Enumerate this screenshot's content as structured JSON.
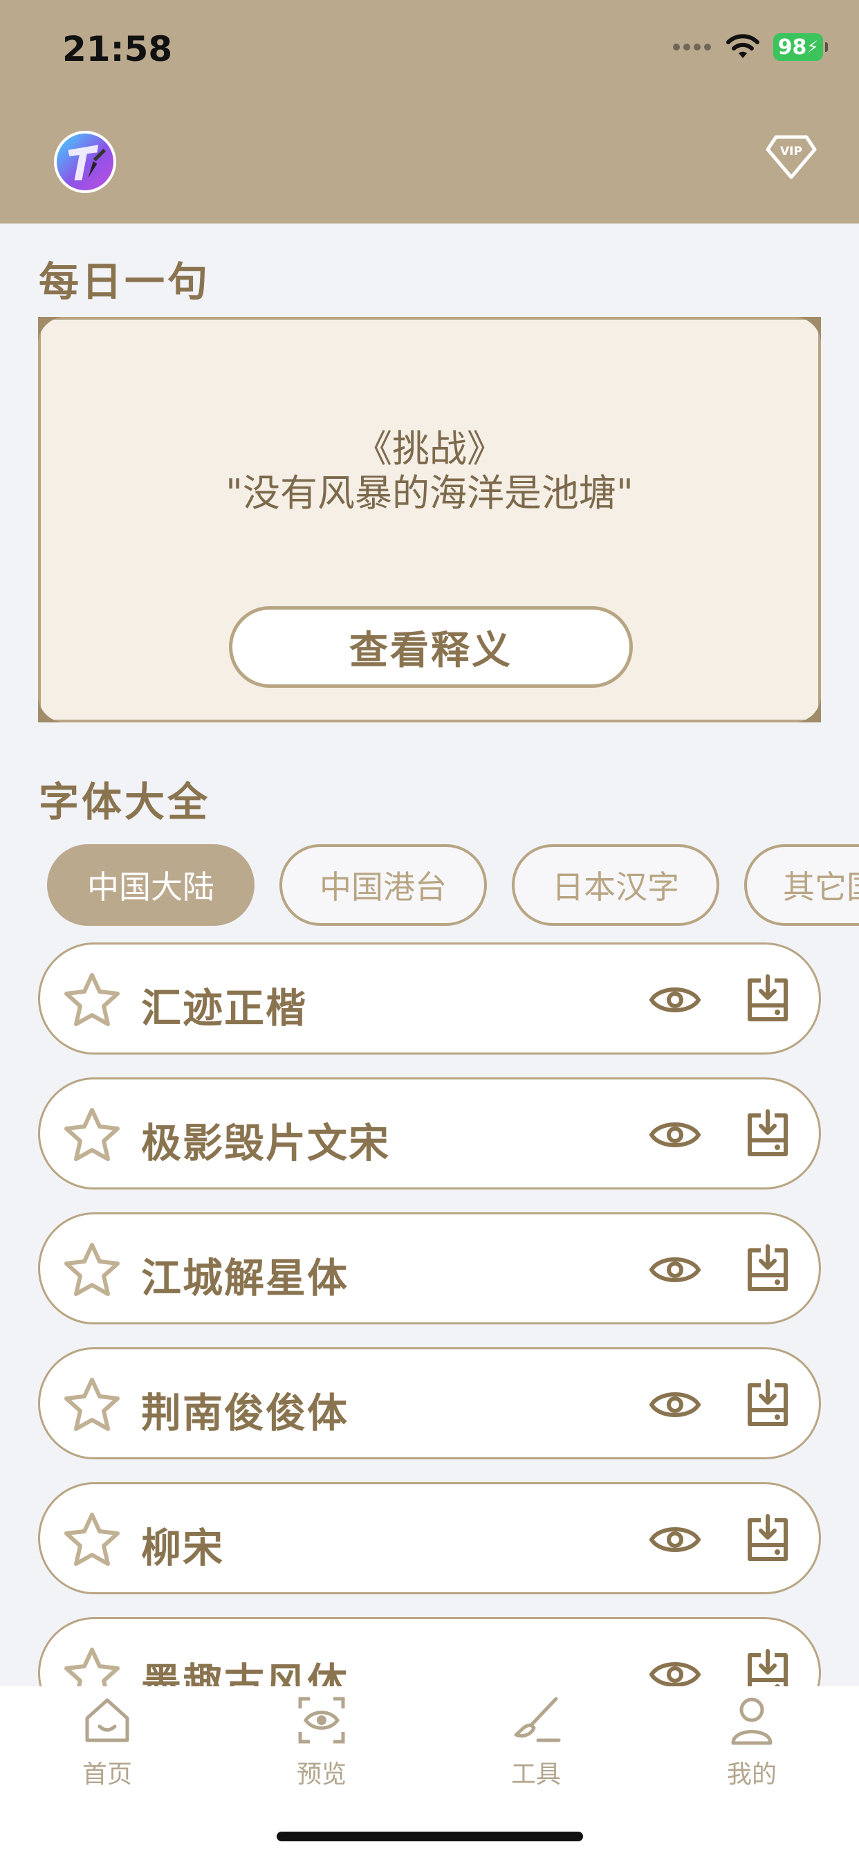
{
  "status_bar": {
    "time": "21:58",
    "battery": "98"
  },
  "header": {
    "vip_label": "VIP"
  },
  "daily": {
    "section_title": "每日一句",
    "book_title": "《挑战》",
    "quote": "\"没有风暴的海洋是池塘\"",
    "button_label": "查看释义"
  },
  "fonts": {
    "section_title": "字体大全",
    "categories": [
      {
        "label": "中国大陆",
        "active": true
      },
      {
        "label": "中国港台",
        "active": false
      },
      {
        "label": "日本汉字",
        "active": false
      },
      {
        "label": "其它国",
        "active": false
      }
    ],
    "items": [
      {
        "name": "汇迹正楷"
      },
      {
        "name": "极影毁片文宋"
      },
      {
        "name": "江城解星体"
      },
      {
        "name": "荆南俊俊体"
      },
      {
        "name": "柳宋"
      },
      {
        "name": "墨趣古风体"
      }
    ]
  },
  "tabbar": {
    "tabs": [
      {
        "label": "首页",
        "icon": "home-icon"
      },
      {
        "label": "预览",
        "icon": "preview-eye-icon"
      },
      {
        "label": "工具",
        "icon": "brush-icon"
      },
      {
        "label": "我的",
        "icon": "profile-icon"
      }
    ]
  },
  "colors": {
    "header_bg": "#bba98e",
    "accent": "#8a7450",
    "border": "#b8a583",
    "card_bg": "#f5efe6",
    "page_bg": "#f2f3f7"
  }
}
